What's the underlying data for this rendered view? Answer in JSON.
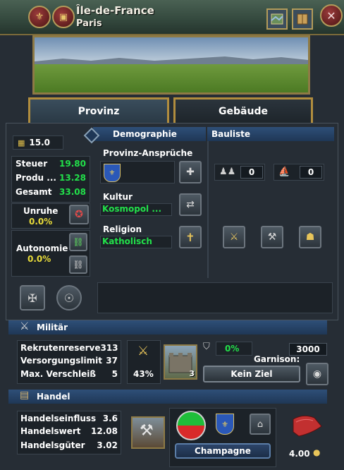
{
  "header": {
    "title": "Île-de-France",
    "subtitle": "Paris"
  },
  "tabs": [
    {
      "label": "Provinz"
    },
    {
      "label": "Gebäude"
    }
  ],
  "provinz": {
    "tax_badge": "15.0",
    "steuer_label": "Steuer",
    "steuer_value": "19.80",
    "produ_label": "Produ ...",
    "produ_value": "13.28",
    "gesamt_label": "Gesamt",
    "gesamt_value": "33.08",
    "unruhe_label": "Unruhe",
    "unruhe_value": "0.0%",
    "autonomie_label": "Autonomie",
    "autonomie_value": "0.0%"
  },
  "demographie": {
    "header": "Demographie",
    "claims_label": "Provinz-Ansprüche",
    "kultur_label": "Kultur",
    "kultur_value": "Kosmopol ...",
    "religion_label": "Religion",
    "religion_value": "Katholisch"
  },
  "bauliste": {
    "header": "Bauliste",
    "count1": "0",
    "count2": "0"
  },
  "militaer": {
    "header": "Militär",
    "rows": [
      {
        "label": "Rekrutenreserve",
        "value": "313"
      },
      {
        "label": "Versorgungslimit",
        "value": "37"
      },
      {
        "label": "Max. Verschleiß",
        "value": "5"
      }
    ],
    "percent": "43%",
    "fort_level": "3",
    "fort_percent": "0%",
    "garrison_value": "3000",
    "garrison_label": "Garnison:",
    "target_button": "Kein Ziel"
  },
  "handel": {
    "header": "Handel",
    "rows": [
      {
        "label": "Handelseinfluss",
        "value": "3.6"
      },
      {
        "label": "Handelswert",
        "value": "12.08"
      },
      {
        "label": "Handelsgüter",
        "value": "3.02"
      }
    ],
    "node": "Champagne",
    "goods_value": "4.00"
  },
  "colors": {
    "accent_gold": "#b18d3e",
    "header_green": "#3f5749",
    "banner_blue": "#2a4868",
    "value_green": "#22e04a",
    "value_yellow": "#e9dc3a"
  }
}
